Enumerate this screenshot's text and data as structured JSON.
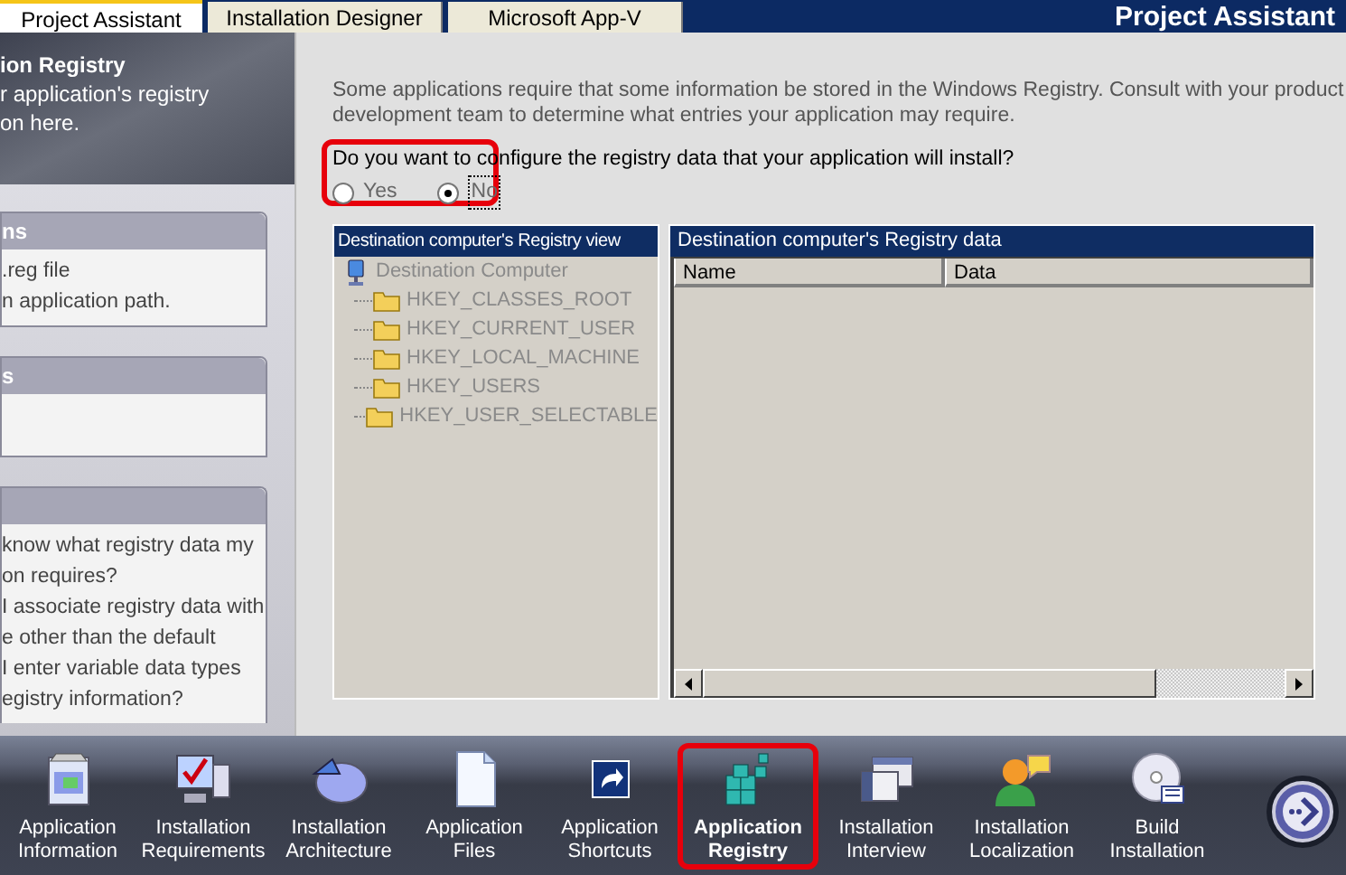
{
  "tabs": [
    {
      "label": "Project Assistant",
      "selected": true
    },
    {
      "label": "Installation Designer",
      "selected": false
    },
    {
      "label": "Microsoft App-V",
      "selected": false
    }
  ],
  "app_title": "Project Assistant",
  "sidebar": {
    "header_lines": [
      "ion Registry",
      "r application's registry",
      "on here."
    ],
    "cards": [
      {
        "title": "ns",
        "lines": [
          ".reg file",
          "n application path."
        ]
      },
      {
        "title": "s"
      },
      {
        "lines": [
          "know what registry data my",
          "on requires?",
          "I associate registry data with",
          "e other than the default",
          "I enter variable data types",
          "egistry information?"
        ]
      }
    ]
  },
  "main": {
    "intro_lines": [
      "Some applications require that some information be stored in the Windows Registry. Consult with your product",
      "development team to determine what entries your application may require."
    ],
    "question": {
      "text": "Do you want to configure the registry data that your application will install?",
      "highlighted": true,
      "options": [
        {
          "label": "Yes",
          "selected": false
        },
        {
          "label": "No",
          "selected": true
        }
      ]
    },
    "tree": {
      "title": "Destination computer's Registry view",
      "disabled": true,
      "root": {
        "label": "Destination Computer",
        "children": [
          {
            "label": "HKEY_CLASSES_ROOT"
          },
          {
            "label": "HKEY_CURRENT_USER"
          },
          {
            "label": "HKEY_LOCAL_MACHINE"
          },
          {
            "label": "HKEY_USERS"
          },
          {
            "label": "HKEY_USER_SELECTABLE"
          }
        ]
      }
    },
    "data_panel": {
      "title": "Destination computer's Registry data",
      "columns": [
        "Name",
        "Data"
      ]
    }
  },
  "nav": {
    "items": [
      {
        "kind": "info",
        "lines": [
          "Application",
          "Information"
        ],
        "selected": false
      },
      {
        "kind": "requirements",
        "lines": [
          "Installation",
          "Requirements"
        ],
        "selected": false
      },
      {
        "kind": "architecture",
        "lines": [
          "Installation",
          "Architecture"
        ],
        "selected": false
      },
      {
        "kind": "files",
        "lines": [
          "Application",
          "Files"
        ],
        "selected": false
      },
      {
        "kind": "shortcuts",
        "lines": [
          "Application",
          "Shortcuts"
        ],
        "selected": false
      },
      {
        "kind": "registry",
        "lines": [
          "Application",
          "Registry"
        ],
        "selected": true
      },
      {
        "kind": "interview",
        "lines": [
          "Installation",
          "Interview"
        ],
        "selected": false
      },
      {
        "kind": "localization",
        "lines": [
          "Installation",
          "Localization"
        ],
        "selected": false
      },
      {
        "kind": "build",
        "lines": [
          "Build",
          "Installation"
        ],
        "selected": false
      }
    ]
  }
}
